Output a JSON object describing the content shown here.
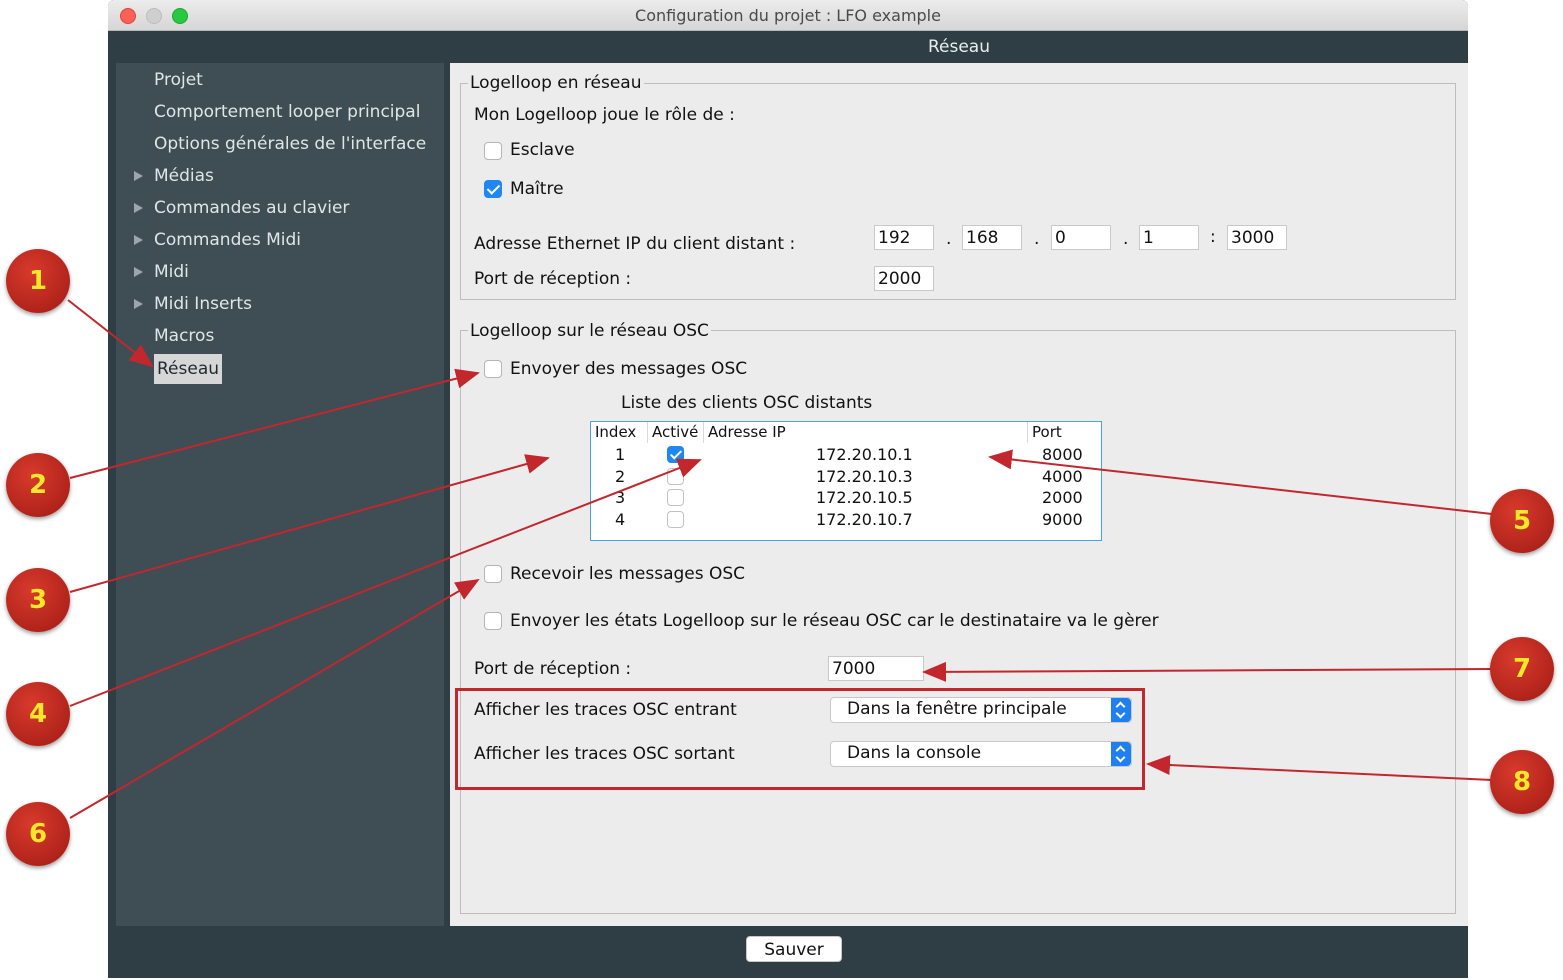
{
  "window": {
    "title": "Configuration du projet : LFO example"
  },
  "header": {
    "section_title": "Réseau"
  },
  "sidebar": {
    "items": [
      {
        "label": "Projet",
        "expandable": false,
        "selected": false
      },
      {
        "label": "Comportement looper principal",
        "expandable": false,
        "selected": false
      },
      {
        "label": "Options générales de l'interface",
        "expandable": false,
        "selected": false
      },
      {
        "label": "Médias",
        "expandable": true,
        "selected": false
      },
      {
        "label": "Commandes au clavier",
        "expandable": true,
        "selected": false
      },
      {
        "label": "Commandes Midi",
        "expandable": true,
        "selected": false
      },
      {
        "label": "Midi",
        "expandable": true,
        "selected": false
      },
      {
        "label": "Midi Inserts",
        "expandable": true,
        "selected": false
      },
      {
        "label": "Macros",
        "expandable": false,
        "selected": false
      },
      {
        "label": "Réseau",
        "expandable": false,
        "selected": true
      }
    ]
  },
  "network": {
    "legend": "Logelloop en réseau",
    "role_label": "Mon Logelloop joue le rôle de :",
    "slave_label": "Esclave",
    "slave_checked": false,
    "master_label": "Maître",
    "master_checked": true,
    "ip_label": "Adresse Ethernet IP du client distant :",
    "ip": [
      "192",
      "168",
      "0",
      "1"
    ],
    "ip_sep": ".",
    "port_sep": ":",
    "ip_port": "3000",
    "recv_port_label": "Port de réception :",
    "recv_port": "2000"
  },
  "osc": {
    "legend": "Logelloop sur le réseau OSC",
    "send_label": "Envoyer des messages OSC",
    "send_checked": false,
    "clients_title": "Liste des clients OSC distants",
    "table": {
      "headers": [
        "Index",
        "Activé",
        "Adresse IP",
        "Port"
      ],
      "rows": [
        {
          "index": "1",
          "active": true,
          "ip": "172.20.10.1",
          "port": "8000"
        },
        {
          "index": "2",
          "active": false,
          "ip": "172.20.10.3",
          "port": "4000"
        },
        {
          "index": "3",
          "active": false,
          "ip": "172.20.10.5",
          "port": "2000"
        },
        {
          "index": "4",
          "active": false,
          "ip": "172.20.10.7",
          "port": "9000"
        }
      ]
    },
    "receive_label": "Recevoir les messages OSC",
    "receive_checked": false,
    "send_states_label": "Envoyer les états Logelloop sur le réseau OSC car le destinataire va le gèrer",
    "send_states_checked": false,
    "recv_port_label": "Port de réception :",
    "recv_port": "7000",
    "trace_in_label": "Afficher les traces OSC entrant",
    "trace_in_value": "Dans la fenêtre principale",
    "trace_out_label": "Afficher les traces OSC sortant",
    "trace_out_value": "Dans la console"
  },
  "footer": {
    "save_label": "Sauver"
  },
  "annotations": [
    "1",
    "2",
    "3",
    "4",
    "5",
    "6",
    "7",
    "8"
  ],
  "colors": {
    "marker": "#c1272d",
    "marker_text": "#f7e92a",
    "accent": "#1e88f0"
  }
}
